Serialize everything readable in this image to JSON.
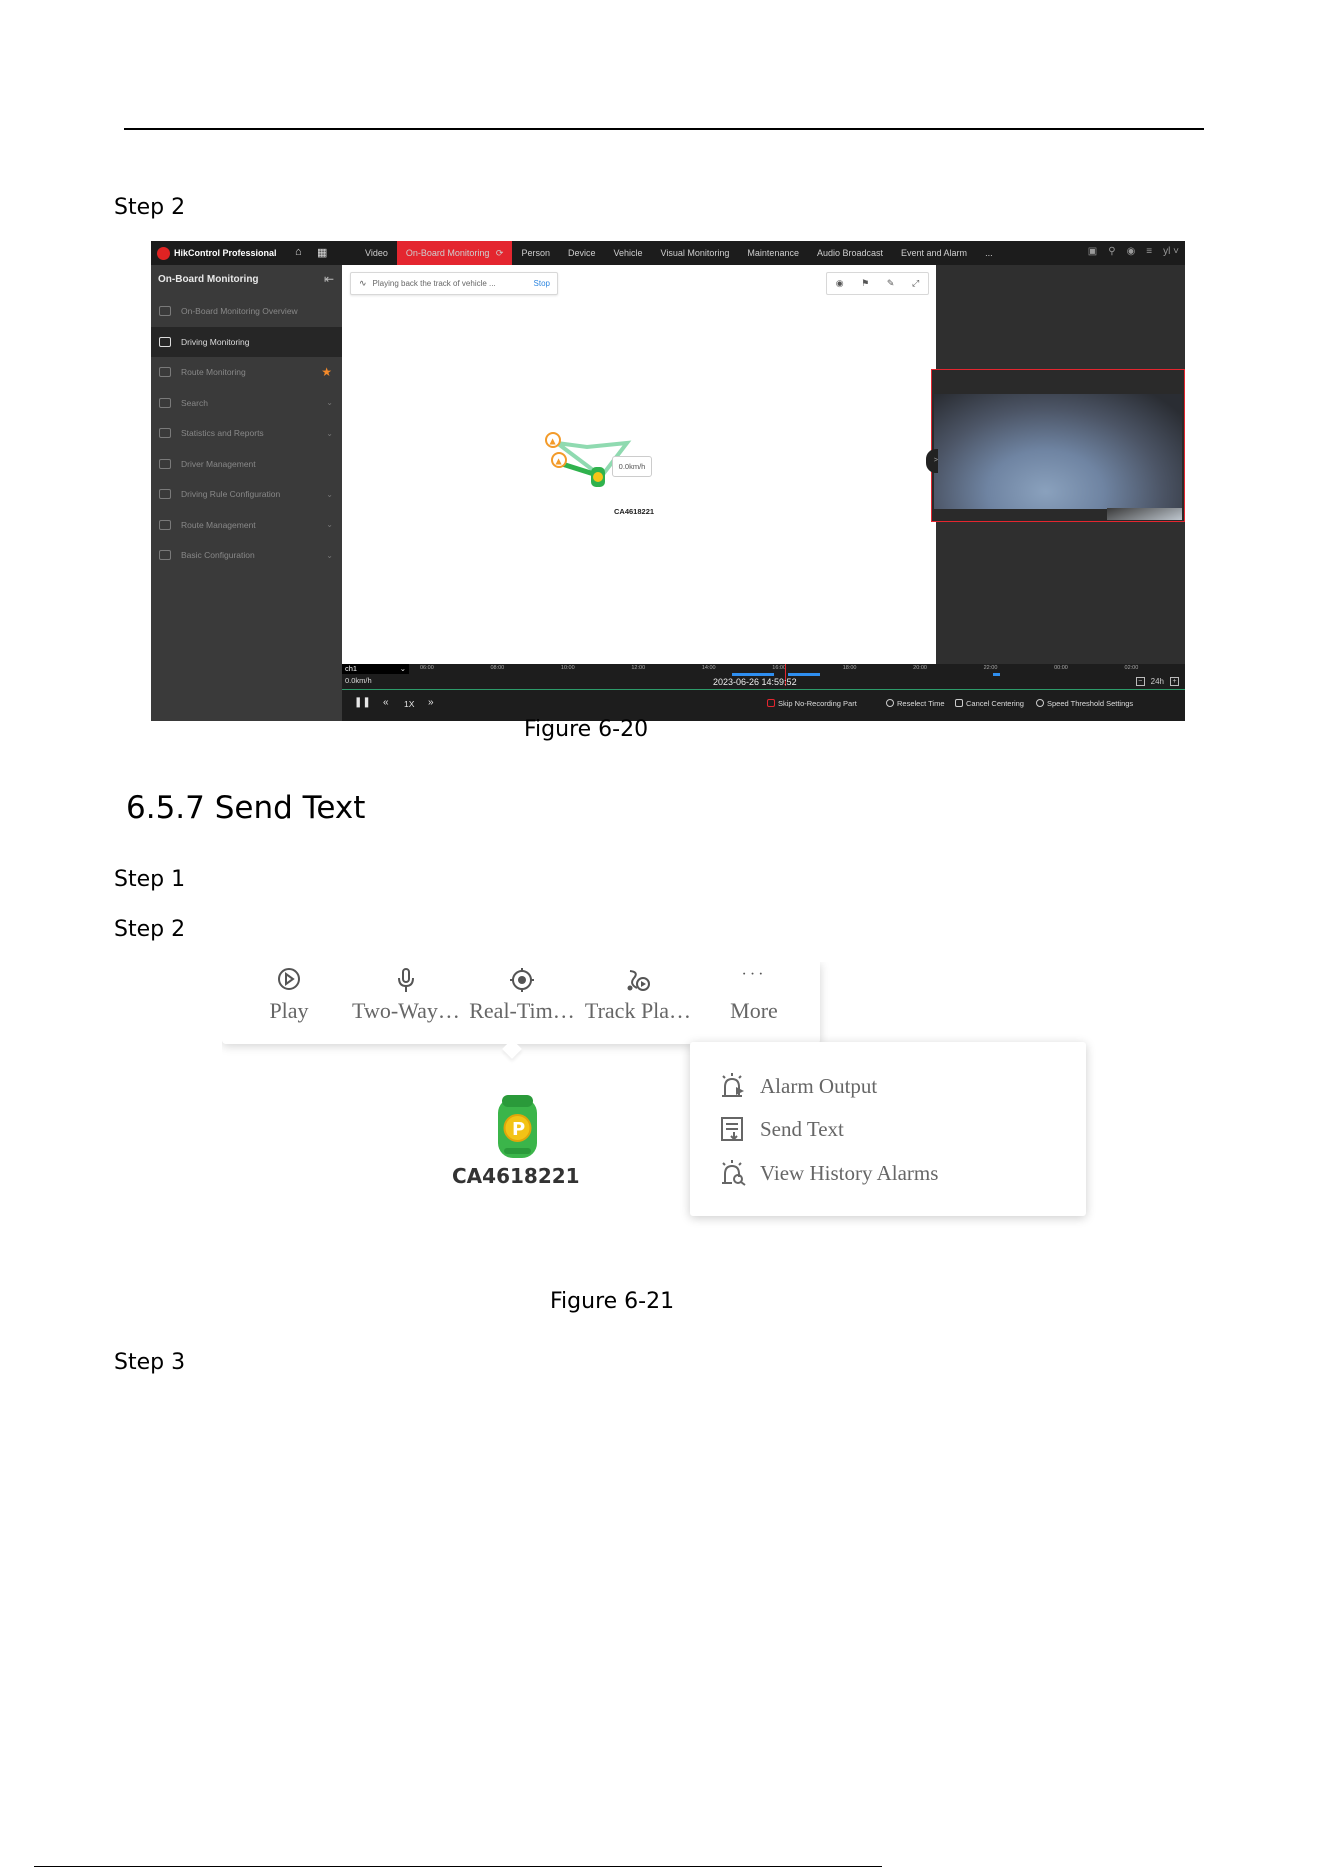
{
  "page": {
    "step_2a": "Step 2",
    "figure_20": "Figure 6-20",
    "section_heading": "6.5.7  Send Text",
    "step_1": "Step 1",
    "step_2b": "Step 2",
    "figure_21": "Figure 6-21",
    "step_3": "Step 3"
  },
  "screenshot1": {
    "app_title": "HikControl Professional",
    "nav_tabs": [
      {
        "label": "Video",
        "active": false
      },
      {
        "label": "On-Board Monitoring",
        "active": true
      },
      {
        "label": "Person",
        "active": false
      },
      {
        "label": "Device",
        "active": false
      },
      {
        "label": "Vehicle",
        "active": false
      },
      {
        "label": "Visual Monitoring",
        "active": false
      },
      {
        "label": "Maintenance",
        "active": false
      },
      {
        "label": "Audio Broadcast",
        "active": false
      },
      {
        "label": "Event and Alarm",
        "active": false
      },
      {
        "label": "...",
        "active": false
      }
    ],
    "user_label": "yl",
    "sidebar": {
      "title": "On-Board Monitoring",
      "items": [
        {
          "label": "On-Board Monitoring Overview",
          "active": false,
          "chevron": false,
          "star": false
        },
        {
          "label": "Driving Monitoring",
          "active": true,
          "chevron": false,
          "star": false
        },
        {
          "label": "Route Monitoring",
          "active": false,
          "chevron": false,
          "star": true
        },
        {
          "label": "Search",
          "active": false,
          "chevron": true,
          "star": false
        },
        {
          "label": "Statistics and Reports",
          "active": false,
          "chevron": true,
          "star": false
        },
        {
          "label": "Driver Management",
          "active": false,
          "chevron": false,
          "star": false
        },
        {
          "label": "Driving Rule Configuration",
          "active": false,
          "chevron": true,
          "star": false
        },
        {
          "label": "Route Management",
          "active": false,
          "chevron": true,
          "star": false
        },
        {
          "label": "Basic Configuration",
          "active": false,
          "chevron": true,
          "star": false
        }
      ]
    },
    "map": {
      "playing_text": "Playing back the track of vehicle ...",
      "stop_label": "Stop",
      "speed_popup": "0.0km/h",
      "vehicle_id": "CA4618221"
    },
    "timeline": {
      "channel": "ch1",
      "speed": "0.0km/h",
      "current_time": "2023-06-26 14:59:52",
      "ticks": [
        "06:00",
        "08:00",
        "10:00",
        "12:00",
        "14:00",
        "16:00",
        "18:00",
        "20:00",
        "22:00",
        "00:00",
        "02:00"
      ],
      "zoom_label": "24h",
      "play_speed": "1X",
      "options": {
        "skip": "Skip No-Recording Part",
        "reselect": "Reselect Time",
        "cancel_centering": "Cancel Centering",
        "speed_threshold": "Speed Threshold Settings"
      }
    },
    "colors": {
      "accent": "#e4262f",
      "star": "#f48a2a",
      "link": "#2d86e0",
      "route": "#3cbf5a"
    }
  },
  "screenshot2": {
    "actions": [
      {
        "label": "Play",
        "icon": "play-icon"
      },
      {
        "label": "Two-Way…",
        "icon": "microphone-icon"
      },
      {
        "label": "Real-Tim…",
        "icon": "location-target-icon"
      },
      {
        "label": "Track Pla…",
        "icon": "track-playback-icon"
      },
      {
        "label": "More",
        "icon": "more-icon"
      }
    ],
    "more_menu": [
      {
        "label": "Alarm Output",
        "icon": "alarm-output-icon"
      },
      {
        "label": "Send Text",
        "icon": "send-text-icon"
      },
      {
        "label": "View History Alarms",
        "icon": "history-alarm-icon"
      }
    ],
    "vehicle_id": "CA4618221"
  }
}
